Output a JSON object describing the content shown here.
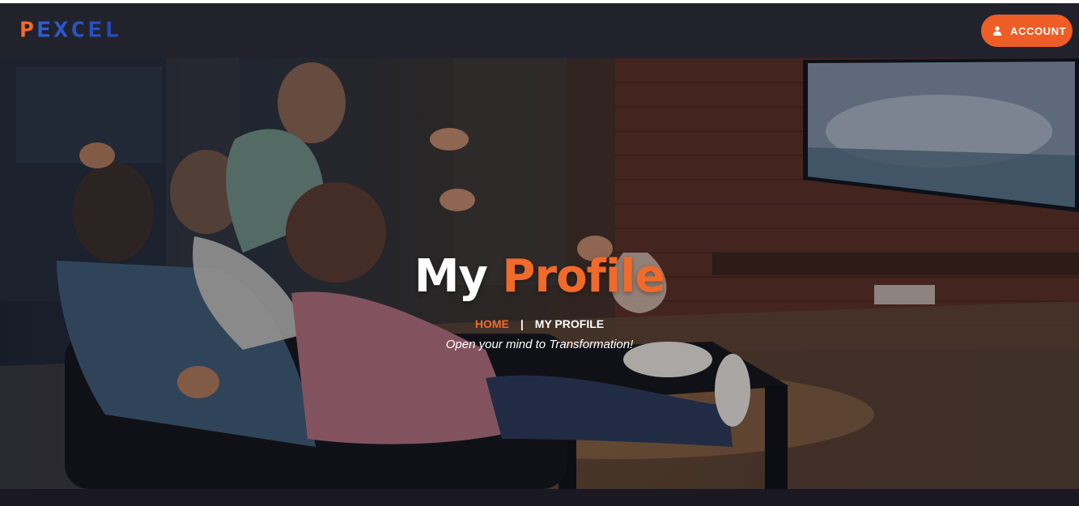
{
  "brand": {
    "logo_text": "PEXCEL",
    "colors": {
      "accent": "#ee5d25",
      "logo_blue": "#2c5fd6",
      "navbar": "#22222d"
    }
  },
  "header": {
    "account_button": {
      "label": "ACCOUNT",
      "icon": "user-icon"
    }
  },
  "hero": {
    "title_part1": "My",
    "title_part2": "Profile",
    "breadcrumb": {
      "home": "HOME",
      "separator": "|",
      "current": "MY PROFILE"
    },
    "tagline": "Open your mind to Transformation!"
  }
}
